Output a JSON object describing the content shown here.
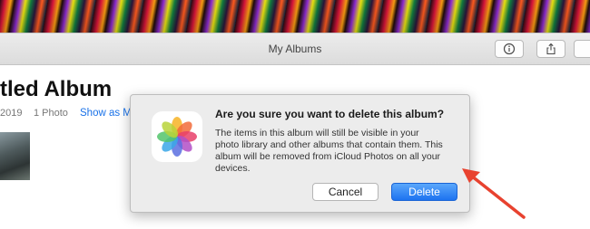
{
  "window": {
    "title": "My Albums"
  },
  "toolbar": {
    "info_icon": "info-icon",
    "share_icon": "share-icon"
  },
  "album": {
    "title": "tled Album",
    "year": "2019",
    "count": "1 Photo",
    "show_as": "Show as M"
  },
  "dialog": {
    "icon": "photos-app-icon",
    "heading": "Are you sure you want to delete this album?",
    "body_lines": [
      "The items in this album will still be visible in your",
      "photo library and other albums that contain them. This",
      "album will be removed from iCloud Photos on all your",
      "devices."
    ],
    "cancel_label": "Cancel",
    "delete_label": "Delete"
  },
  "annotation": {
    "arrow_color": "#e8422f"
  },
  "colors": {
    "accent": "#1d73f0",
    "link": "#1a72e8"
  }
}
